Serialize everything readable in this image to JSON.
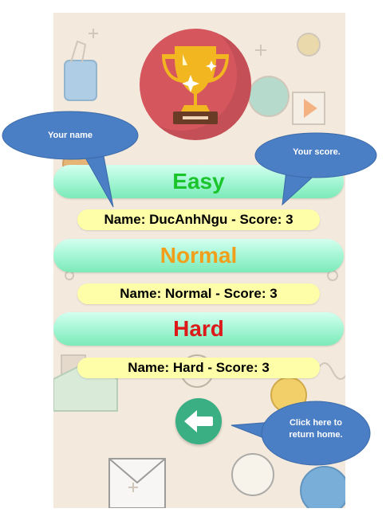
{
  "levels": [
    {
      "title": "Easy",
      "title_color": "#1ac42b",
      "score_text": "Name: DucAnhNgu - Score: 3"
    },
    {
      "title": "Normal",
      "title_color": "#f19e1b",
      "score_text": "Name: Normal - Score: 3"
    },
    {
      "title": "Hard",
      "title_color": "#dd1a1a",
      "score_text": "Name: Hard - Score: 3"
    }
  ],
  "icons": {
    "trophy": "trophy-icon",
    "back": "arrow-left-icon"
  },
  "annotations": {
    "name_label": "Your name",
    "score_label": "Your score.",
    "home_label_line1": "Click here to",
    "home_label_line2": "return home."
  },
  "colors": {
    "callout": "#4a7ec5",
    "trophy_bg": "#d6565e",
    "back_button": "#3aaf84",
    "level_bar": "#a9f7d8",
    "score_pill": "#fffea8"
  }
}
